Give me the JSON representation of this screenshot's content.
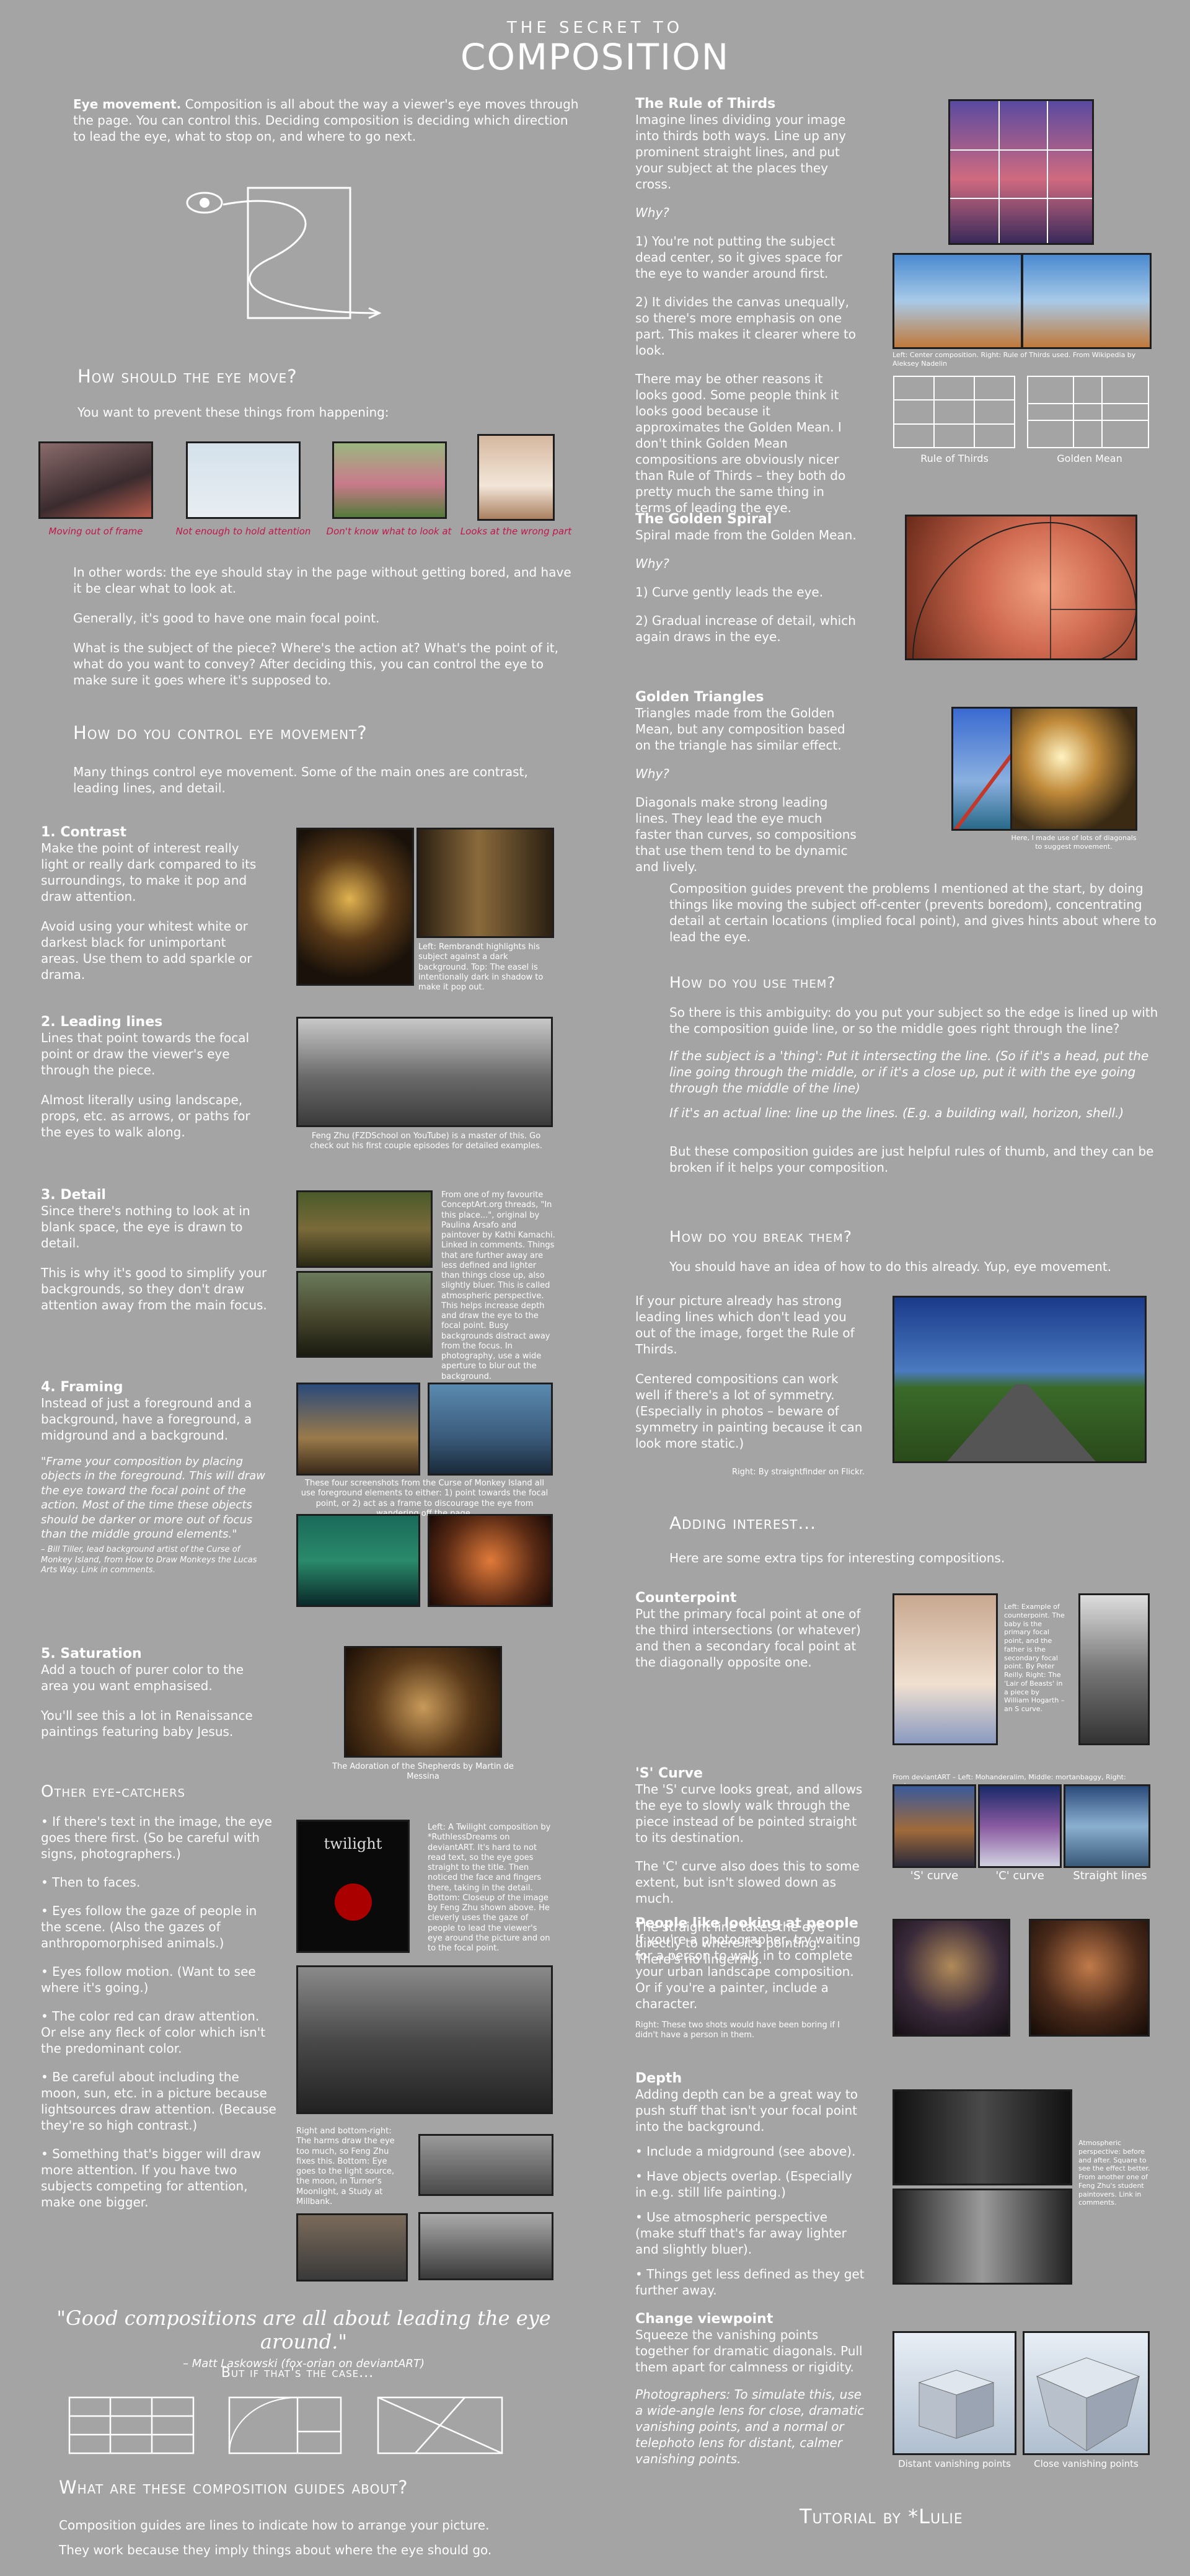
{
  "header": {
    "kicker": "THE SECRET TO",
    "title": "COMPOSITION"
  },
  "intro": {
    "lead": "Eye movement.",
    "text": " Composition is all about the way a viewer's eye moves through the page. You can control this. Deciding composition is deciding which direction to lead the eye, what to stop on, and where to go next."
  },
  "eye_move": {
    "heading": "How should the eye move?",
    "prevent": "You want to prevent these things from happening:",
    "thumbs": [
      {
        "label": "Moving out of frame"
      },
      {
        "label": "Not enough to hold attention"
      },
      {
        "label": "Don't know what to look at"
      },
      {
        "label": "Looks at the wrong part"
      }
    ],
    "p1": "In other words: the eye should stay in the page without getting bored, and have it be clear what to look at.",
    "p2": "Generally, it's good to have one main focal point.",
    "p3": "What is the subject of the piece? Where's the action at? What's the point of it, what do you want to convey? After deciding this, you can control the eye to make sure it goes where it's supposed to."
  },
  "control": {
    "heading": "How do you control eye movement?",
    "text": "Many things control eye movement. Some of the main ones are contrast, leading lines, and detail."
  },
  "contrast": {
    "heading": "1. Contrast",
    "p1": "Make the point of interest really light or really dark compared to its surroundings, to make it pop and draw attention.",
    "p2": "Avoid using your whitest white or darkest black for unimportant areas. Use them to add sparkle or drama.",
    "cap": "Left: Rembrandt highlights his subject against a dark background. Top: The easel is intentionally dark in shadow to make it pop out."
  },
  "leading": {
    "heading": "2. Leading lines",
    "p1": "Lines that point towards the focal point or draw the viewer's eye through the piece.",
    "p2": "Almost literally using landscape, props, etc. as arrows, or paths for the eyes to walk along.",
    "cap": "Feng Zhu (FZDSchool on YouTube) is a master of this. Go check out his first couple episodes for detailed examples."
  },
  "detail": {
    "heading": "3. Detail",
    "p1": "Since there's nothing to look at in blank space, the eye is drawn to detail.",
    "p2": "This is why it's good to simplify your backgrounds, so they don't draw attention away from the main focus.",
    "cap": "From one of my favourite ConceptArt.org threads, \"In this place...\", original by Paulina Arsafo and paintover by Kathi Kamachi. Linked in comments. Things that are further away are less defined and lighter than things close up, also slightly bluer. This is called atmospheric perspective. This helps increase depth and draw the eye to the focal point. Busy backgrounds distract away from the focus. In photography, use a wide aperture to blur out the background."
  },
  "framing": {
    "heading": "4. Framing",
    "p1": "Instead of just a foreground and a background, have a foreground, a midground and a background.",
    "quote": "\"Frame your composition by placing objects in the foreground. This will draw the eye toward the focal point of the action. Most of the time these objects should be darker or more out of focus than the middle ground elements.\"",
    "attr": "– Bill Tiller, lead background artist of the Curse of Monkey Island, from How to Draw Monkeys the Lucas Arts Way. Link in comments.",
    "cap": "These four screenshots from the Curse of Monkey Island all use foreground elements to either: 1) point towards the focal point, or 2) act as a frame to discourage the eye from wandering off the page."
  },
  "saturation": {
    "heading": "5. Saturation",
    "p1": "Add a touch of purer color to the area you want emphasised.",
    "p2": "You'll see this a lot in Renaissance paintings featuring baby Jesus.",
    "cap": "The Adoration of the Shepherds by Martin de Messina"
  },
  "other": {
    "heading": "Other eye-catchers",
    "items": [
      "• If there's text in the image, the eye goes there first. (So be careful with signs, photographers.)",
      "• Then to faces.",
      "• Eyes follow the gaze of people in the scene. (Also the gazes of anthropomorphised animals.)",
      "• Eyes follow motion. (Want to see where it's going.)",
      "• The color red can draw attention. Or else any fleck of color which isn't the predominant color.",
      "• Be careful about including the moon, sun, etc. in a picture because lightsources draw attention. (Because they're so high contrast.)",
      "• Something that's bigger will draw more attention. If you have two subjects competing for attention, make one bigger."
    ],
    "book": "twilight",
    "cap1": "Left: A Twilight composition by *RuthlessDreams on deviantART. It's hard to not read text, so the eye goes straight to the title. Then noticed the face and fingers there, taking in the detail. Bottom: Closeup of the image by Feng Zhu shown above. He cleverly uses the gaze of people to lead the viewer's eye around the picture and on to the focal point.",
    "cap2": "Right and bottom-right: The harms draw the eye too much, so Feng Zhu fixes this. Bottom: Eye goes to the light source, the moon, in Turner's Moonlight, a Study at Millbank."
  },
  "quote": {
    "text": "\"Good compositions are all about leading the eye around.\"",
    "author": "– Matt Laskowski (fox-orian on deviantART)"
  },
  "but": "But if that's the case...",
  "guides": {
    "heading": "What are these composition guides about?",
    "p1": "Composition guides are lines to indicate how to arrange your picture.",
    "p2": "They work because they imply things about where the eye should go."
  },
  "thirds": {
    "heading": "The Rule of Thirds",
    "p1": "Imagine lines dividing your image into thirds both ways. Line up any prominent straight lines, and put your subject at the places they cross.",
    "why": "Why?",
    "p2": "1) You're not putting the subject dead center, so it gives space for the eye to wander around first.",
    "p3": "2) It divides the canvas unequally, so there's more emphasis on one part. This makes it clearer where to look.",
    "p4": "There may be other reasons it looks good. Some people think it looks good because it approximates the Golden Mean. I don't think Golden Mean compositions are obviously nicer than Rule of Thirds – they both do pretty much the same thing in terms of leading the eye.",
    "cap": "Left: Center composition. Right: Rule of Thirds used. From Wikipedia by Aleksey Nadelin",
    "g1": "Rule of Thirds",
    "g2": "Golden Mean"
  },
  "spiral": {
    "heading": "The Golden Spiral",
    "p1": "Spiral made from the Golden Mean.",
    "why": "Why?",
    "p2": "1) Curve gently leads the eye.",
    "p3": "2) Gradual increase of detail, which again draws in the eye."
  },
  "triangles": {
    "heading": "Golden Triangles",
    "p1": "Triangles made from the Golden Mean, but any composition based on the triangle has similar effect.",
    "why": "Why?",
    "p2": "Diagonals make strong leading lines. They lead the eye much faster than curves, so compositions that use them tend to be dynamic and lively.",
    "cap": "Here, I made use of lots of diagonals to suggest movement."
  },
  "guides2": {
    "text": "Composition guides prevent the problems I mentioned at the start, by doing things like moving the subject off-center (prevents boredom), concentrating detail at certain locations (implied focal point), and gives hints about where to lead the eye."
  },
  "use": {
    "heading": "How do you use them?",
    "p1": "So there is this ambiguity: do you put your subject so the edge is lined up with the composition guide line, or so the middle goes right through the line?",
    "p2": "If the subject is a 'thing': Put it intersecting the line. (So if it's a head, put the line going through the middle, or if it's a close up, put it with the eye going through the middle of the line)",
    "p3": "If it's an actual line: line up the lines. (E.g. a building wall, horizon, shell.)",
    "p4": "But these composition guides are just helpful rules of thumb, and they can be broken if it helps your composition."
  },
  "break": {
    "heading": "How do you break them?",
    "p1": "You should have an idea of how to do this already. Yup, eye movement.",
    "p2": "If your picture already has strong leading lines which don't lead you out of the image, forget the Rule of Thirds.",
    "p3": "Centered compositions can work well if there's a lot of symmetry. (Especially in photos – beware of symmetry in painting because it can look more static.)",
    "cap": "Right: By straightfinder on Flickr."
  },
  "interest": {
    "heading": "Adding interest...",
    "sub": "Here are some extra tips for interesting compositions."
  },
  "counter": {
    "heading": "Counterpoint",
    "p1": "Put the primary focal point at one of the third intersections (or whatever) and then a secondary focal point at the diagonally opposite one.",
    "cap": "Left: Example of counterpoint. The baby is the primary focal point, and the father is the secondary focal point. By Peter Reilly. Right: The 'Lair of Beasts' in a piece by William Hogarth – an S curve."
  },
  "scurve": {
    "heading": "'S' Curve",
    "p1": "The 'S' curve looks great, and allows the eye to slowly walk through the piece instead of be pointed straight to its destination.",
    "p2": "The 'C' curve also does this to some extent, but isn't slowed down as much.",
    "p3": "The straight line takes the eye directly to where it's pointing. There's no lingering.",
    "cap": "From deviantART – Left: Mohanderalim, Middle: mortanbaggy, Right: cozione",
    "l1": "'S' curve",
    "l2": "'C' curve",
    "l3": "Straight lines"
  },
  "people": {
    "heading": "People like looking at people",
    "p1": "If you're a photographer, try waiting for a person to walk in to complete your urban landscape composition. Or if you're a painter, include a character.",
    "cap": "Right: These two shots would have been boring if I didn't have a person in them."
  },
  "depth": {
    "heading": "Depth",
    "p1": "Adding depth can be a great way to push stuff that isn't your focal point into the background.",
    "items": [
      "• Include a midground (see above).",
      "• Have objects overlap. (Especially in e.g. still life painting.)",
      "• Use atmospheric perspective (make stuff that's far away lighter and slightly bluer).",
      "• Things get less defined as they get further away."
    ],
    "cap": "Atmospheric perspective: before and after. Square to see the effect better. From another one of Feng Zhu's student paintovers. Link in comments."
  },
  "viewpoint": {
    "heading": "Change viewpoint",
    "p1": "Squeeze the vanishing points together for dramatic diagonals. Pull them apart for calmness or rigidity.",
    "p2": "Photographers: To simulate this, use a wide-angle lens for close, dramatic vanishing points, and a normal or telephoto lens for distant, calmer vanishing points.",
    "l1": "Distant vanishing points",
    "l2": "Close vanishing points"
  },
  "credit": "Tutorial by *Lulie",
  "colors": {
    "background": "#a4a4a4",
    "accent": "#c0174a"
  }
}
